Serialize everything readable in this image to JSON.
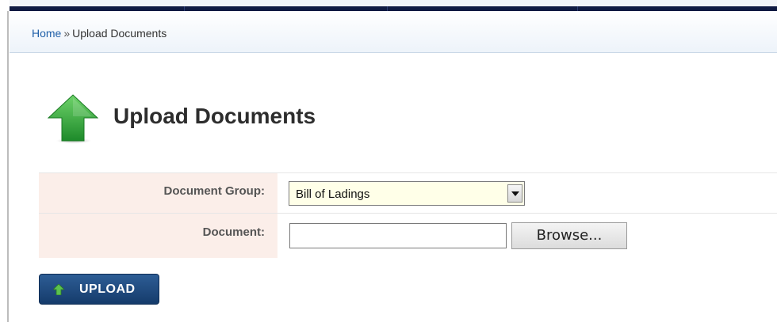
{
  "breadcrumb": {
    "home": "Home",
    "separator": "»",
    "current": "Upload Documents"
  },
  "page": {
    "title": "Upload Documents",
    "title_icon": "green-up-arrow-icon"
  },
  "form": {
    "document_group": {
      "label": "Document Group:",
      "selected": "Bill of Ladings"
    },
    "document": {
      "label": "Document:",
      "value": "",
      "browse_label": "Browse..."
    }
  },
  "actions": {
    "upload_label": "UPLOAD",
    "upload_icon": "up-arrow-icon"
  },
  "colors": {
    "nav_band": "#101a42",
    "label_bg": "#fbeee9",
    "select_bg": "#ffffe8",
    "upload_button": "#1f4a80",
    "link": "#1f5fa8",
    "arrow_green": "#2fa53a"
  }
}
